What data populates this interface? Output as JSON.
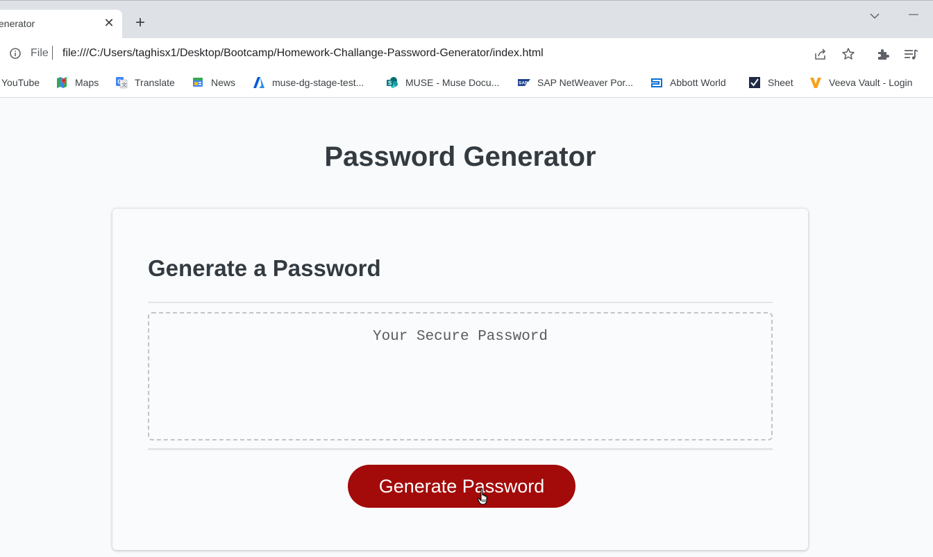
{
  "browser": {
    "tab": {
      "title": "enerator",
      "close_icon": "close-icon"
    },
    "new_tab_icon": "plus-icon",
    "address": {
      "site_label": "File",
      "url": "file:///C:/Users/taghisx1/Desktop/Bootcamp/Homework-Challange-Password-Generator/index.html"
    },
    "bookmarks": [
      {
        "label": "YouTube",
        "icon": "youtube-icon"
      },
      {
        "label": "Maps",
        "icon": "maps-icon"
      },
      {
        "label": "Translate",
        "icon": "translate-icon"
      },
      {
        "label": "News",
        "icon": "news-icon"
      },
      {
        "label": "muse-dg-stage-test...",
        "icon": "azure-icon"
      },
      {
        "label": "MUSE - Muse Docu...",
        "icon": "sharepoint-icon"
      },
      {
        "label": "SAP NetWeaver Por...",
        "icon": "sap-icon"
      },
      {
        "label": "Abbott World",
        "icon": "abbott-icon"
      },
      {
        "label": "Sheet",
        "icon": "sheet-icon"
      },
      {
        "label": "Veeva Vault - Login",
        "icon": "veeva-icon"
      }
    ]
  },
  "page": {
    "title": "Password Generator",
    "card": {
      "header": "Generate a Password",
      "password_placeholder": "Your Secure Password",
      "button_label": "Generate Password"
    }
  },
  "colors": {
    "button": "#a30a0a",
    "heading": "#333b41"
  }
}
